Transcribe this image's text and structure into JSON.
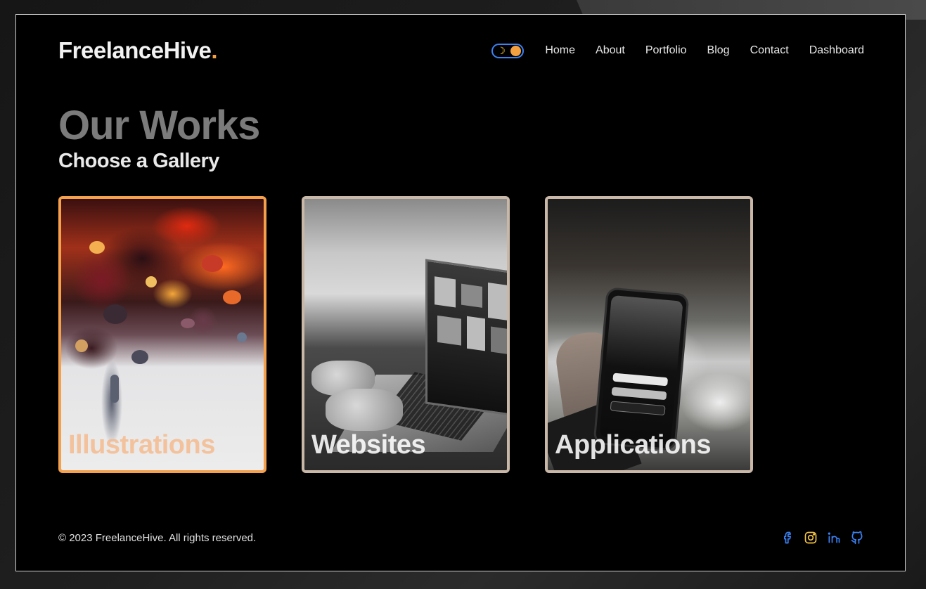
{
  "brand": {
    "name": "FreelanceHive",
    "dot": ".",
    "accent": "#f5a040"
  },
  "theme_toggle": {
    "icon": "moon-icon",
    "accent": "#3b82f6"
  },
  "nav": {
    "links": [
      {
        "label": "Home"
      },
      {
        "label": "About"
      },
      {
        "label": "Portfolio"
      },
      {
        "label": "Blog"
      },
      {
        "label": "Contact"
      },
      {
        "label": "Dashboard"
      }
    ]
  },
  "hero": {
    "title": "Our Works",
    "subtitle": "Choose a Gallery"
  },
  "gallery": {
    "items": [
      {
        "label": "Illustrations",
        "active": true,
        "border_color": "#f5a04a"
      },
      {
        "label": "Websites",
        "active": false,
        "border_color": "#c9b8a8"
      },
      {
        "label": "Applications",
        "active": false,
        "border_color": "#c9b8a8"
      }
    ]
  },
  "footer": {
    "copyright": "© 2023 FreelanceHive. All rights reserved.",
    "socials": [
      {
        "icon": "facebook-icon",
        "color": "#3b82f6"
      },
      {
        "icon": "instagram-icon",
        "color": "#f5c542"
      },
      {
        "icon": "linkedin-icon",
        "color": "#3b82f6"
      },
      {
        "icon": "github-icon",
        "color": "#3b82f6"
      }
    ]
  }
}
